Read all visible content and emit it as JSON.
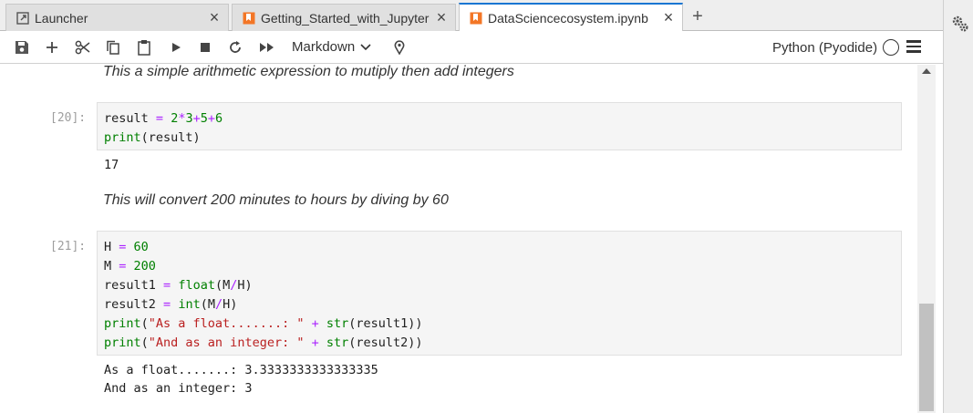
{
  "tabs": [
    {
      "label": "Launcher",
      "icon": "launcher-icon",
      "close": "×"
    },
    {
      "label": "Getting_Started_with_Jupyter",
      "icon": "notebook-icon",
      "close": "×"
    },
    {
      "label": "DataSciencecosystem.ipynb",
      "icon": "notebook-icon",
      "close": "×",
      "active": true
    }
  ],
  "tab_add": "+",
  "toolbar": {
    "buttons": [
      "save-icon",
      "add-cell-icon",
      "cut-icon",
      "copy-icon",
      "paste-icon",
      "run-icon",
      "stop-icon",
      "restart-icon",
      "run-all-icon"
    ],
    "cell_type": "Markdown",
    "kernel_name": "Python (Pyodide)"
  },
  "cells": {
    "md1": "This a simple arithmetic expression to mutiply then add integers",
    "prompt20": "[20]:",
    "out20": "17",
    "md2": "This will convert 200 minutes to hours by diving by 60",
    "prompt21": "[21]:",
    "out21_line1": "As a float.......: 3.3333333333333335",
    "out21_line2": "And as an integer: 3"
  },
  "colors": {
    "accent": "#1976d2",
    "notebook_icon": "#f37626",
    "keyword": "#008000",
    "operator": "#aa22ff",
    "string": "#ba2121"
  }
}
